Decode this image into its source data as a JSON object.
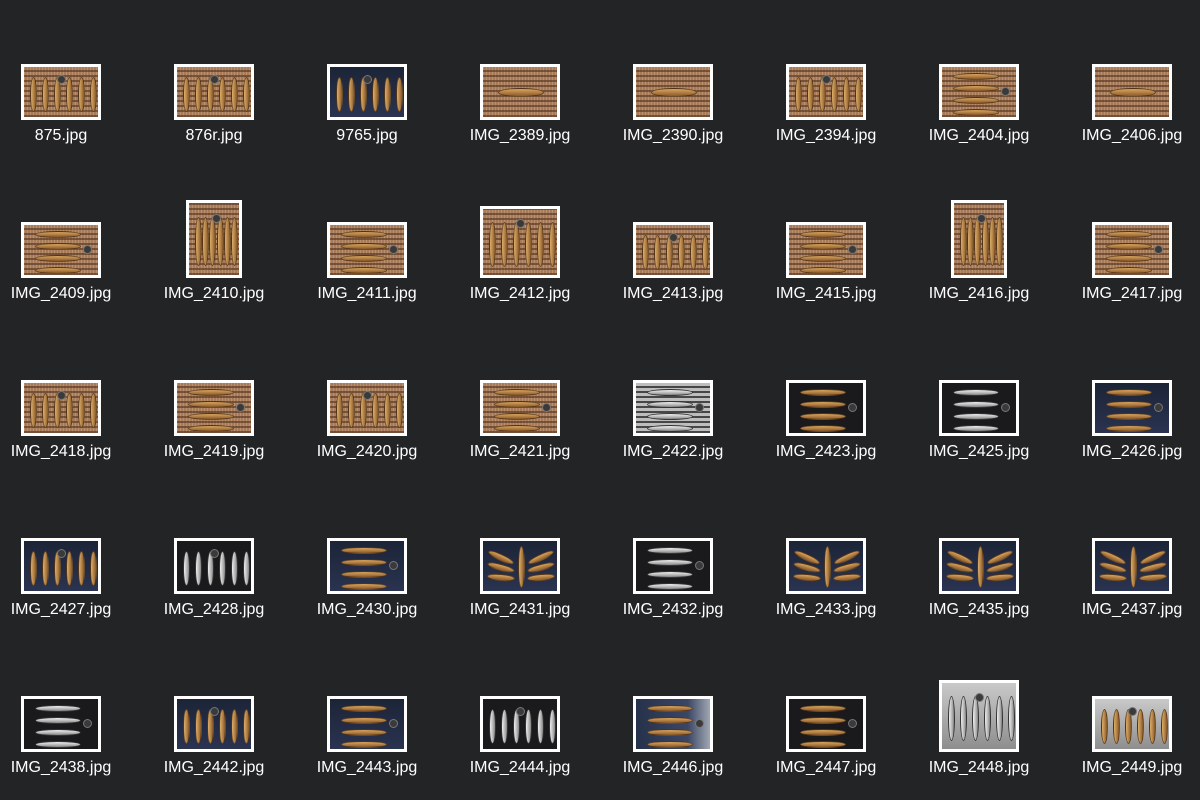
{
  "files": [
    {
      "name": "875.jpg",
      "kind": "land",
      "bg": "wicker",
      "motif": "vert"
    },
    {
      "name": "876r.jpg",
      "kind": "land",
      "bg": "wicker",
      "motif": "vert"
    },
    {
      "name": "9765.jpg",
      "kind": "land",
      "bg": "navy",
      "motif": "vert"
    },
    {
      "name": "IMG_2389.jpg",
      "kind": "land",
      "bg": "wicker",
      "motif": "one"
    },
    {
      "name": "IMG_2390.jpg",
      "kind": "land",
      "bg": "wicker",
      "motif": "one"
    },
    {
      "name": "IMG_2394.jpg",
      "kind": "land",
      "bg": "wicker",
      "motif": "vert"
    },
    {
      "name": "IMG_2404.jpg",
      "kind": "land",
      "bg": "wicker",
      "motif": "horiz"
    },
    {
      "name": "IMG_2406.jpg",
      "kind": "land",
      "bg": "wicker",
      "motif": "one"
    },
    {
      "name": "IMG_2409.jpg",
      "kind": "land",
      "bg": "wicker",
      "motif": "horiz"
    },
    {
      "name": "IMG_2410.jpg",
      "kind": "port",
      "bg": "wicker",
      "motif": "vert"
    },
    {
      "name": "IMG_2411.jpg",
      "kind": "land",
      "bg": "wicker",
      "motif": "horiz"
    },
    {
      "name": "IMG_2412.jpg",
      "kind": "sq",
      "bg": "wicker",
      "motif": "vert"
    },
    {
      "name": "IMG_2413.jpg",
      "kind": "land",
      "bg": "wicker",
      "motif": "vert"
    },
    {
      "name": "IMG_2415.jpg",
      "kind": "land",
      "bg": "wicker",
      "motif": "horiz"
    },
    {
      "name": "IMG_2416.jpg",
      "kind": "port",
      "bg": "wicker",
      "motif": "vert"
    },
    {
      "name": "IMG_2417.jpg",
      "kind": "land",
      "bg": "wicker",
      "motif": "horiz"
    },
    {
      "name": "IMG_2418.jpg",
      "kind": "land",
      "bg": "wicker",
      "motif": "vert"
    },
    {
      "name": "IMG_2419.jpg",
      "kind": "land",
      "bg": "wicker",
      "motif": "horiz"
    },
    {
      "name": "IMG_2420.jpg",
      "kind": "land",
      "bg": "wicker",
      "motif": "vert"
    },
    {
      "name": "IMG_2421.jpg",
      "kind": "land",
      "bg": "wicker",
      "motif": "horiz"
    },
    {
      "name": "IMG_2422.jpg",
      "kind": "land",
      "bg": "bw",
      "motif": "horizsilver"
    },
    {
      "name": "IMG_2423.jpg",
      "kind": "land",
      "bg": "dark",
      "motif": "horiz"
    },
    {
      "name": "IMG_2425.jpg",
      "kind": "land",
      "bg": "dark",
      "motif": "horizsilver"
    },
    {
      "name": "IMG_2426.jpg",
      "kind": "land",
      "bg": "navy",
      "motif": "horiz"
    },
    {
      "name": "IMG_2427.jpg",
      "kind": "land",
      "bg": "navy",
      "motif": "vert"
    },
    {
      "name": "IMG_2428.jpg",
      "kind": "land",
      "bg": "dark",
      "motif": "vertsilver"
    },
    {
      "name": "IMG_2430.jpg",
      "kind": "land",
      "bg": "navy",
      "motif": "horiz"
    },
    {
      "name": "IMG_2431.jpg",
      "kind": "land",
      "bg": "navy",
      "motif": "fan"
    },
    {
      "name": "IMG_2432.jpg",
      "kind": "land",
      "bg": "dark",
      "motif": "horizsilver"
    },
    {
      "name": "IMG_2433.jpg",
      "kind": "land",
      "bg": "navy",
      "motif": "fan"
    },
    {
      "name": "IMG_2435.jpg",
      "kind": "land",
      "bg": "navy",
      "motif": "fan"
    },
    {
      "name": "IMG_2437.jpg",
      "kind": "land",
      "bg": "navy",
      "motif": "fan"
    },
    {
      "name": "IMG_2438.jpg",
      "kind": "land",
      "bg": "dark",
      "motif": "horizsilver"
    },
    {
      "name": "IMG_2442.jpg",
      "kind": "land",
      "bg": "navy",
      "motif": "vert"
    },
    {
      "name": "IMG_2443.jpg",
      "kind": "land",
      "bg": "navy",
      "motif": "horiz"
    },
    {
      "name": "IMG_2444.jpg",
      "kind": "land",
      "bg": "dark",
      "motif": "vertsilver"
    },
    {
      "name": "IMG_2446.jpg",
      "kind": "land",
      "bg": "gradient",
      "motif": "horiz"
    },
    {
      "name": "IMG_2447.jpg",
      "kind": "land",
      "bg": "dark",
      "motif": "horiz"
    },
    {
      "name": "IMG_2448.jpg",
      "kind": "sq",
      "bg": "grey",
      "motif": "vertsilver"
    },
    {
      "name": "IMG_2449.jpg",
      "kind": "land",
      "bg": "grey",
      "motif": "vert"
    }
  ]
}
